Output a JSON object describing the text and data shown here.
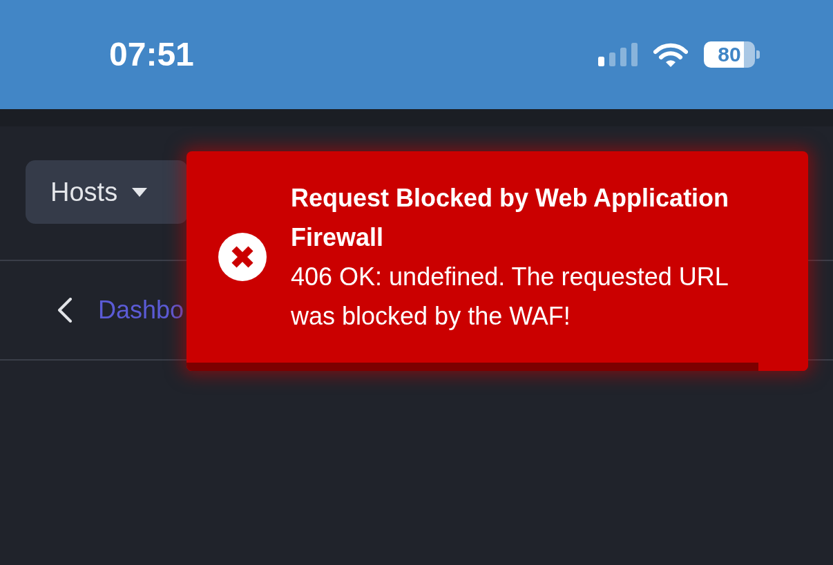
{
  "status_bar": {
    "time": "07:51",
    "battery": "80"
  },
  "toolbar": {
    "host_menu": {
      "label": "Hosts"
    }
  },
  "breadcrumb": {
    "link": "Dashbo"
  },
  "toast": {
    "kind": "error",
    "title": "Request Blocked by Web Application Firewall",
    "message": "406 OK: undefined. The requested URL was blocked by the WAF!",
    "progress": {
      "level": 0.92
    }
  }
}
